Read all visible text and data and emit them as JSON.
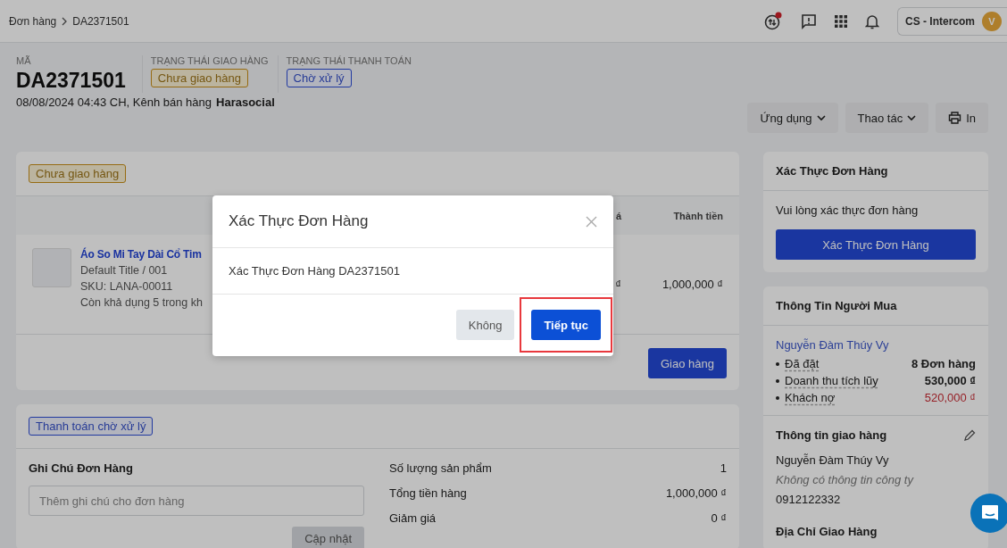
{
  "breadcrumb": [
    "Đơn hàng",
    "DA2371501"
  ],
  "topbar": {
    "icons": [
      {
        "kind": "transfer",
        "badge": true
      },
      {
        "kind": "feedback"
      },
      {
        "kind": "apps"
      },
      {
        "kind": "bell"
      }
    ],
    "account": {
      "name": "CS - Intercom",
      "avatar": "V"
    }
  },
  "order": {
    "code_label": "MÃ",
    "code": "DA2371501",
    "fulfillment_label": "TRẠNG THÁI GIAO HÀNG",
    "fulfillment_status": "Chưa giao hàng",
    "payment_label": "TRẠNG THÁI THANH TOÁN",
    "payment_status": "Chờ xử lý",
    "meta": "08/08/2024 04:43 CH, Kênh bán hàng",
    "channel": "Harasocial"
  },
  "actions": [
    {
      "label": "Ứng dụng",
      "kind": "dropdown"
    },
    {
      "label": "Thao tác",
      "kind": "dropdown"
    },
    {
      "label": "In",
      "kind": "print"
    }
  ],
  "fulfillment_card": {
    "status": "Chưa giao hàng",
    "columns": [
      "á",
      "Thành tiền"
    ],
    "item": {
      "name": "Áo So Mi Tay Dài Cổ Tim",
      "variant": "Default Title / 001",
      "sku": "SKU: LANA-00011",
      "stock": "Còn khả dụng 5 trong kh",
      "unit_price": "₫",
      "total": "1,000,000 ₫"
    },
    "button": "Giao hàng"
  },
  "payment_card": {
    "status": "Thanh toán chờ xử lý",
    "note_title": "Ghi Chú Đơn Hàng",
    "note_placeholder": "Thêm ghi chú cho đơn hàng",
    "update_button": "Cập nhật",
    "summary": [
      {
        "label": "Số lượng sản phẩm",
        "value": "1"
      },
      {
        "label": "Tổng tiền hàng",
        "value": "1,000,000 ₫"
      },
      {
        "label": "Giảm giá",
        "value": "0 ₫"
      }
    ]
  },
  "verify_card": {
    "title": "Xác Thực Đơn Hàng",
    "text": "Vui lòng xác thực đơn hàng",
    "button": "Xác Thực Đơn Hàng"
  },
  "buyer_card": {
    "title": "Thông Tin Người Mua",
    "name": "Nguyễn Đàm Thúy Vy",
    "stats": [
      {
        "label": "Đã đặt",
        "value": "8 Đơn hàng",
        "kind": "normal"
      },
      {
        "label": "Doanh thu tích lũy",
        "value": "530,000 ₫",
        "kind": "normal"
      },
      {
        "label": "Khách nợ",
        "value": "520,000 ₫",
        "kind": "debt"
      }
    ]
  },
  "shipping_card": {
    "title": "Thông tin giao hàng",
    "name": "Nguyễn Đàm Thúy Vy",
    "company": "Không có thông tin công ty",
    "phone": "0912122332",
    "address_title": "Địa Chỉ Giao Hàng"
  },
  "modal": {
    "title": "Xác Thực Đơn Hàng",
    "message": "Xác Thực Đơn Hàng DA2371501",
    "cancel": "Không",
    "confirm": "Tiếp tục",
    "confirm_highlighted": true
  }
}
